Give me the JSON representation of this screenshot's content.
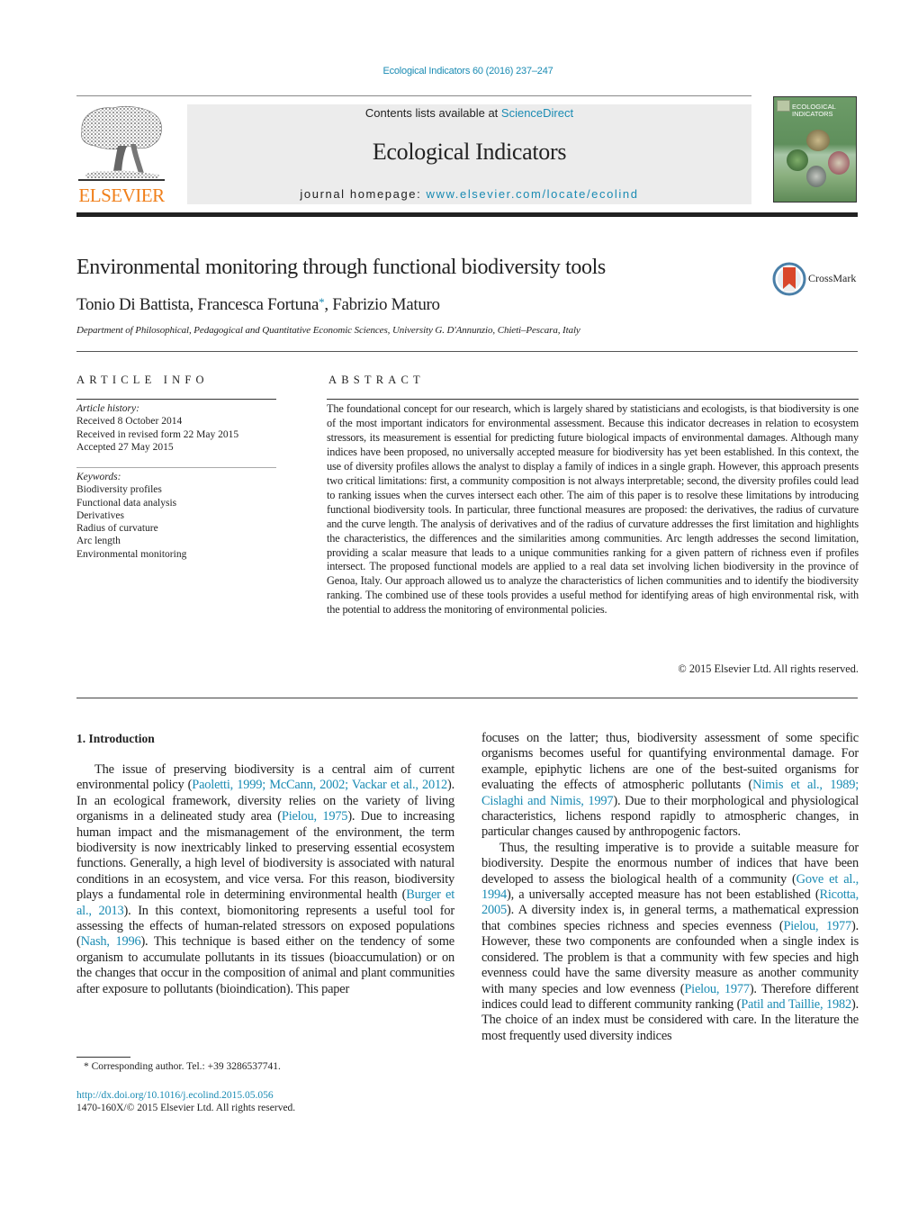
{
  "header": {
    "journal_ref": "Ecological Indicators 60 (2016) 237–247",
    "contents_prefix": "Contents lists available at ",
    "contents_link": "ScienceDirect",
    "journal_name": "Ecological Indicators",
    "homepage_prefix": "journal homepage: ",
    "homepage_link": "www.elsevier.com/locate/ecolind",
    "publisher_logo_text": "ELSEVIER",
    "cover_title_line1": "ECOLOGICAL",
    "cover_title_line2": "INDICATORS",
    "brand_orange": "#f07f1a",
    "link_color": "#1a8bb3"
  },
  "article": {
    "title": "Environmental monitoring through functional biodiversity tools",
    "crossmark_label": "CrossMark",
    "authors": [
      {
        "name": "Tonio Di Battista",
        "corresponding": false
      },
      {
        "name": "Francesca Fortuna",
        "corresponding": true
      },
      {
        "name": "Fabrizio Maturo",
        "corresponding": false
      }
    ],
    "author_sep": ", ",
    "corresponding_mark": "*",
    "affiliation": "Department of Philosophical, Pedagogical and Quantitative Economic Sciences, University G. D'Annunzio, Chieti–Pescara, Italy"
  },
  "article_info": {
    "heading": "ARTICLE INFO",
    "history_heading": "Article history:",
    "history": [
      "Received 8 October 2014",
      "Received in revised form 22 May 2015",
      "Accepted 27 May 2015"
    ],
    "keywords_heading": "Keywords:",
    "keywords": [
      "Biodiversity profiles",
      "Functional data analysis",
      "Derivatives",
      "Radius of curvature",
      "Arc length",
      "Environmental monitoring"
    ]
  },
  "abstract": {
    "heading": "ABSTRACT",
    "text": "The foundational concept for our research, which is largely shared by statisticians and ecologists, is that biodiversity is one of the most important indicators for environmental assessment. Because this indicator decreases in relation to ecosystem stressors, its measurement is essential for predicting future biological impacts of environmental damages. Although many indices have been proposed, no universally accepted measure for biodiversity has yet been established. In this context, the use of diversity profiles allows the analyst to display a family of indices in a single graph. However, this approach presents two critical limitations: first, a community composition is not always interpretable; second, the diversity profiles could lead to ranking issues when the curves intersect each other. The aim of this paper is to resolve these limitations by introducing functional biodiversity tools. In particular, three functional measures are proposed: the derivatives, the radius of curvature and the curve length. The analysis of derivatives and of the radius of curvature addresses the first limitation and highlights the characteristics, the differences and the similarities among communities. Arc length addresses the second limitation, providing a scalar measure that leads to a unique communities ranking for a given pattern of richness even if profiles intersect. The proposed functional models are applied to a real data set involving lichen biodiversity in the province of Genoa, Italy. Our approach allowed us to analyze the characteristics of lichen communities and to identify the biodiversity ranking. The combined use of these tools provides a useful method for identifying areas of high environmental risk, with the potential to address the monitoring of environmental policies.",
    "copyright": "© 2015 Elsevier Ltd. All rights reserved."
  },
  "introduction": {
    "heading": "1.  Introduction",
    "left_p1": [
      {
        "t": "The issue of preserving biodiversity is a central aim of current environmental policy ("
      },
      {
        "t": "Paoletti, 1999; McCann, 2002; Vackar et al., 2012",
        "link": true
      },
      {
        "t": "). In an ecological framework, diversity relies on the variety of living organisms in a delineated study area ("
      },
      {
        "t": "Pielou, 1975",
        "link": true
      },
      {
        "t": "). Due to increasing human impact and the mismanagement of the environment, the term biodiversity is now inextricably linked to preserving essential ecosystem functions. Generally, a high level of biodiversity is associated with natural conditions in an ecosystem, and vice versa. For this reason, biodiversity plays a fundamental role in determining environmental health ("
      },
      {
        "t": "Burger et al., 2013",
        "link": true
      },
      {
        "t": "). In this context, biomonitoring represents a useful tool for assessing the effects of human-related stressors on exposed populations ("
      },
      {
        "t": "Nash, 1996",
        "link": true
      },
      {
        "t": "). This technique is based either on the tendency of some organism to accumulate pollutants in its tissues (bioaccumulation) or on the changes that occur in the composition of animal and plant communities after exposure to pollutants (bioindication). This paper"
      }
    ],
    "right_p1": [
      {
        "t": "focuses on the latter; thus, biodiversity assessment of some specific organisms becomes useful for quantifying environmental damage. For example, epiphytic lichens are one of the best-suited organisms for evaluating the effects of atmospheric pollutants ("
      },
      {
        "t": "Nimis et al., 1989; Cislaghi and Nimis, 1997",
        "link": true
      },
      {
        "t": "). Due to their morphological and physiological characteristics, lichens respond rapidly to atmospheric changes, in particular changes caused by anthropogenic factors."
      }
    ],
    "right_p2": [
      {
        "t": "Thus, the resulting imperative is to provide a suitable measure for biodiversity. Despite the enormous number of indices that have been developed to assess the biological health of a community ("
      },
      {
        "t": "Gove et al., 1994",
        "link": true
      },
      {
        "t": "), a universally accepted measure has not been established ("
      },
      {
        "t": "Ricotta, 2005",
        "link": true
      },
      {
        "t": "). A diversity index is, in general terms, a mathematical expression that combines species richness and species evenness ("
      },
      {
        "t": "Pielou, 1977",
        "link": true
      },
      {
        "t": "). However, these two components are confounded when a single index is considered. The problem is that a community with few species and high evenness could have the same diversity measure as another community with many species and low evenness ("
      },
      {
        "t": "Pielou, 1977",
        "link": true
      },
      {
        "t": "). Therefore different indices could lead to different community ranking ("
      },
      {
        "t": "Patil and Taillie, 1982",
        "link": true
      },
      {
        "t": "). The choice of an index must be considered with care. In the literature the most frequently used diversity indices"
      }
    ]
  },
  "footer": {
    "footnote": "* Corresponding author. Tel.: +39 3286537741.",
    "doi": "http://dx.doi.org/10.1016/j.ecolind.2015.05.056",
    "issn": "1470-160X/© 2015 Elsevier Ltd. All rights reserved."
  }
}
